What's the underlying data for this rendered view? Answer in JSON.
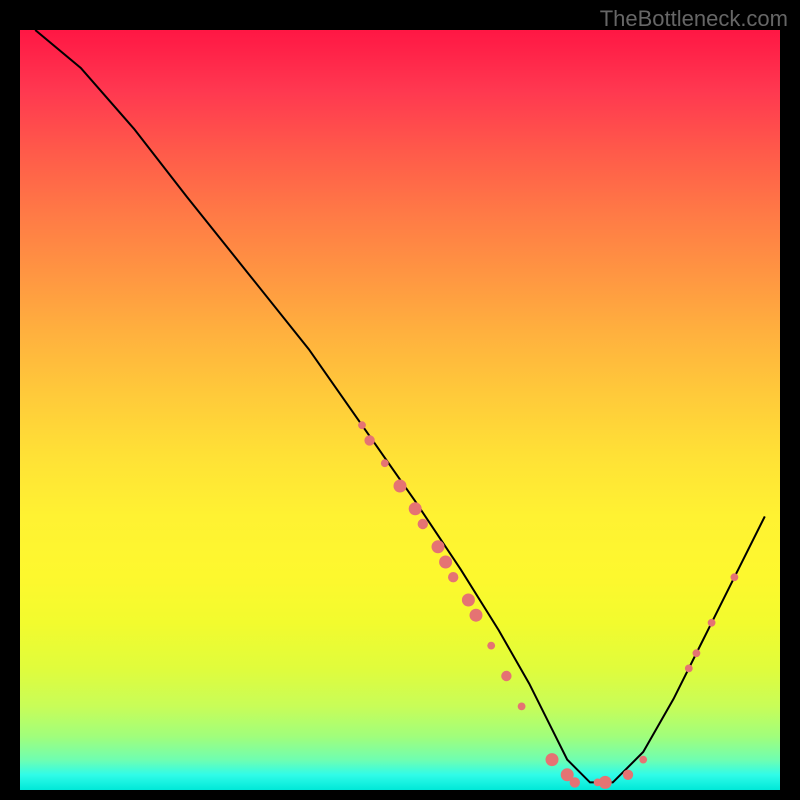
{
  "watermark": "TheBottleneck.com",
  "chart_data": {
    "type": "line",
    "title": "",
    "xlabel": "",
    "ylabel": "",
    "xlim": [
      0,
      100
    ],
    "ylim": [
      0,
      100
    ],
    "series": [
      {
        "name": "curve",
        "x": [
          2,
          8,
          15,
          22,
          30,
          38,
          45,
          52,
          58,
          63,
          67,
          70,
          72,
          75,
          78,
          82,
          86,
          90,
          94,
          98
        ],
        "y": [
          100,
          95,
          87,
          78,
          68,
          58,
          48,
          38,
          29,
          21,
          14,
          8,
          4,
          1,
          1,
          5,
          12,
          20,
          28,
          36
        ]
      }
    ],
    "markers": [
      {
        "x": 45,
        "y": 48,
        "size": 3
      },
      {
        "x": 46,
        "y": 46,
        "size": 4
      },
      {
        "x": 48,
        "y": 43,
        "size": 3
      },
      {
        "x": 50,
        "y": 40,
        "size": 5
      },
      {
        "x": 52,
        "y": 37,
        "size": 5
      },
      {
        "x": 53,
        "y": 35,
        "size": 4
      },
      {
        "x": 55,
        "y": 32,
        "size": 5
      },
      {
        "x": 56,
        "y": 30,
        "size": 5
      },
      {
        "x": 57,
        "y": 28,
        "size": 4
      },
      {
        "x": 59,
        "y": 25,
        "size": 5
      },
      {
        "x": 60,
        "y": 23,
        "size": 5
      },
      {
        "x": 62,
        "y": 19,
        "size": 3
      },
      {
        "x": 64,
        "y": 15,
        "size": 4
      },
      {
        "x": 66,
        "y": 11,
        "size": 3
      },
      {
        "x": 70,
        "y": 4,
        "size": 5
      },
      {
        "x": 72,
        "y": 2,
        "size": 5
      },
      {
        "x": 73,
        "y": 1,
        "size": 4
      },
      {
        "x": 76,
        "y": 1,
        "size": 3
      },
      {
        "x": 77,
        "y": 1,
        "size": 5
      },
      {
        "x": 80,
        "y": 2,
        "size": 4
      },
      {
        "x": 82,
        "y": 4,
        "size": 3
      },
      {
        "x": 88,
        "y": 16,
        "size": 3
      },
      {
        "x": 89,
        "y": 18,
        "size": 3
      },
      {
        "x": 91,
        "y": 22,
        "size": 3
      },
      {
        "x": 94,
        "y": 28,
        "size": 3
      }
    ],
    "gradient_stops": [
      {
        "pos": 0,
        "color": "#ff1744"
      },
      {
        "pos": 50,
        "color": "#ffd53a"
      },
      {
        "pos": 100,
        "color": "#00e8d8"
      }
    ]
  }
}
